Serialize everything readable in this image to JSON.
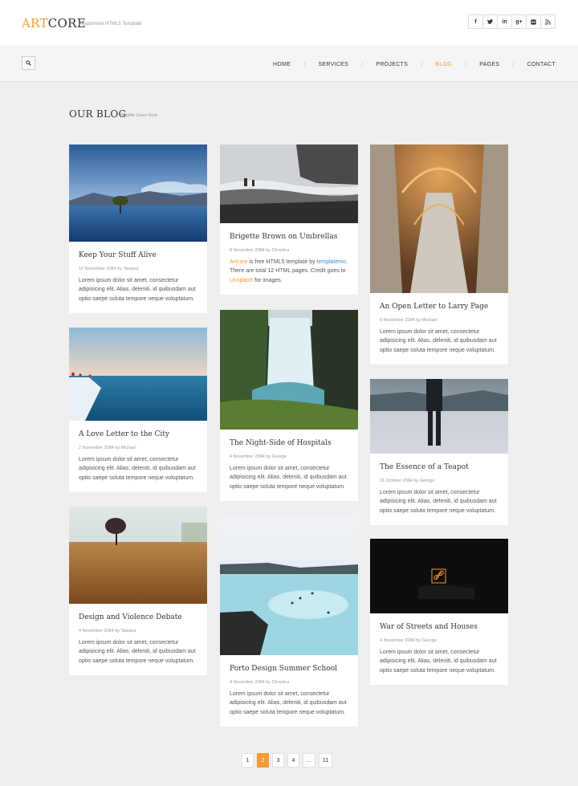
{
  "header": {
    "logo_part1": "ART",
    "logo_part2": "CORE",
    "tagline": "Responsive HTML5 Template",
    "social": [
      {
        "icon": "facebook-icon",
        "glyph": "f"
      },
      {
        "icon": "twitter-icon",
        "glyph": "t"
      },
      {
        "icon": "linkedin-icon",
        "glyph": "in"
      },
      {
        "icon": "google-plus-icon",
        "glyph": "g+"
      },
      {
        "icon": "flickr-icon",
        "glyph": "◘"
      },
      {
        "icon": "rss-icon",
        "glyph": "ʀ"
      }
    ]
  },
  "nav": {
    "items": [
      "HOME",
      "SERVICES",
      "PROJECTS",
      "BLOG",
      "PAGES",
      "CONTACT"
    ],
    "active": "BLOG",
    "separator": "/"
  },
  "page": {
    "title": "OUR BLOG",
    "subtitle": "Subtitle Goes Here"
  },
  "posts": [
    {
      "title": "Keep Your Stuff Alive",
      "meta": "10 November 2084 by Tawana",
      "text": "Lorem ipsum dolor sit amet, consectetur adipisicing elit. Alias, deleniti, id quibusdam aut optio saepe soluta tempore neque voluptatum."
    },
    {
      "title": "Brigette Brown on Umbrellas",
      "meta": "8 November 2084 by Christina",
      "text_parts": [
        "Artcore",
        " is free HTML5 template by ",
        "templatemo",
        ". There are total 12 HTML pages. Credit goes to ",
        "Unsplash",
        " for images."
      ]
    },
    {
      "title": "An Open Letter to Larry Page",
      "meta": "6 November 2084 by Michael",
      "text": "Lorem ipsum dolor sit amet, consectetur adipisicing elit. Alias, deleniti, id quibusdam aut optio saepe soluta tempore neque voluptatum."
    },
    {
      "title": "A Love Letter to the City",
      "meta": "2 November 2084 by Michael",
      "text": "Lorem ipsum dolor sit amet, consectetur adipisicing elit. Alias, deleniti, id quibusdam aut optio saepe soluta tempore neque voluptatum."
    },
    {
      "title": "The Night-Side of Hospitals",
      "meta": "4 November 2084 by George",
      "text": "Lorem ipsum dolor sit amet, consectetur adipisicing elit. Alias, deleniti, id quibusdam aut optio saepe soluta tempore neque voluptatum."
    },
    {
      "title": "The Essence of a Teapot",
      "meta": "31 October 2084 by George",
      "text": "Lorem ipsum dolor sit amet, consectetur adipisicing elit. Alias, deleniti, id quibusdam aut optio saepe soluta tempore neque voluptatum."
    },
    {
      "title": "Design and Violence Debate",
      "meta": "4 November 2084 by Tawana",
      "text": "Lorem ipsum dolor sit amet, consectetur adipisicing elit. Alias, deleniti, id quibusdam aut optio saepe soluta tempore neque voluptatum."
    },
    {
      "title": "Porto Design Summer School",
      "meta": "4 November 2084 by Christina",
      "text": "Lorem ipsum dolor sit amet, consectetur adipisicing elit. Alias, deleniti, id quibusdam aut optio saepe soluta tempore neque voluptatum."
    },
    {
      "title": "War of Streets and Houses",
      "meta": "4 November 2084 by George",
      "text": "Lorem ipsum dolor sit amet, consectetur adipisicing elit. Alias, deleniti, id quibusdam aut optio saepe soluta tempore neque voluptatum."
    }
  ],
  "pagination": [
    "1",
    "2",
    "3",
    "4",
    "...",
    "11"
  ],
  "pagination_active": "2",
  "colors": {
    "accent": "#f39c34",
    "link_blue": "#3a8fd0",
    "background": "#efefef"
  }
}
